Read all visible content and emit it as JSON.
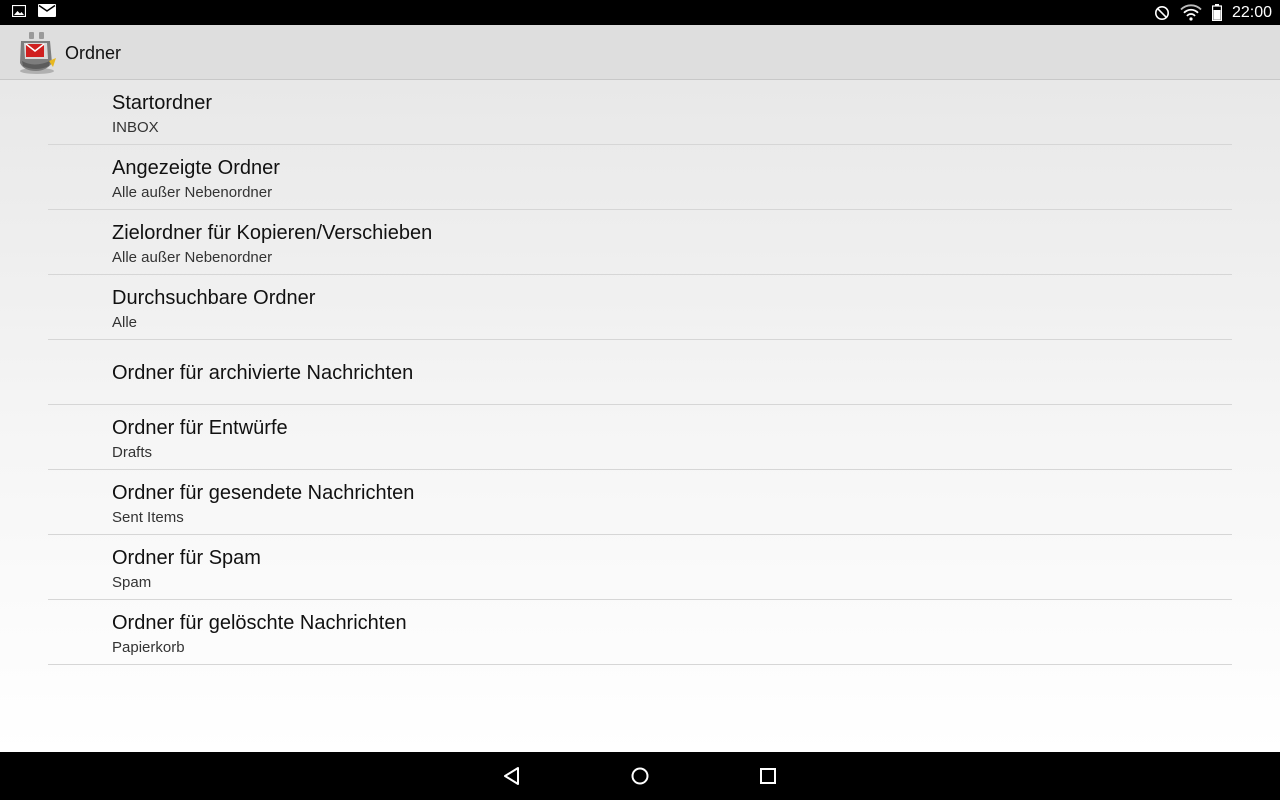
{
  "status_bar": {
    "time": "22:00",
    "left_icons": [
      "image-notification-icon",
      "email-notification-icon"
    ],
    "right_icons": [
      "do-not-disturb-icon",
      "wifi-icon",
      "battery-icon"
    ]
  },
  "action_bar": {
    "title": "Ordner",
    "app_icon": "k9-mail-app-icon"
  },
  "preferences": [
    {
      "title": "Startordner",
      "summary": "INBOX"
    },
    {
      "title": "Angezeigte Ordner",
      "summary": "Alle außer Nebenordner"
    },
    {
      "title": "Zielordner für Kopieren/Verschieben",
      "summary": "Alle außer Nebenordner"
    },
    {
      "title": "Durchsuchbare Ordner",
      "summary": "Alle"
    },
    {
      "title": "Ordner für archivierte Nachrichten",
      "summary": ""
    },
    {
      "title": "Ordner für Entwürfe",
      "summary": "Drafts"
    },
    {
      "title": "Ordner für gesendete Nachrichten",
      "summary": "Sent Items"
    },
    {
      "title": "Ordner für Spam",
      "summary": "Spam"
    },
    {
      "title": "Ordner für gelöschte Nachrichten",
      "summary": "Papierkorb"
    }
  ],
  "nav_bar": {
    "buttons": [
      "back-icon",
      "home-icon",
      "recents-icon"
    ]
  },
  "colors": {
    "status_bar": "#000000",
    "action_bar": "#dedede",
    "divider": "#d6d6d6",
    "text_primary": "#111111",
    "text_secondary": "#333333"
  }
}
